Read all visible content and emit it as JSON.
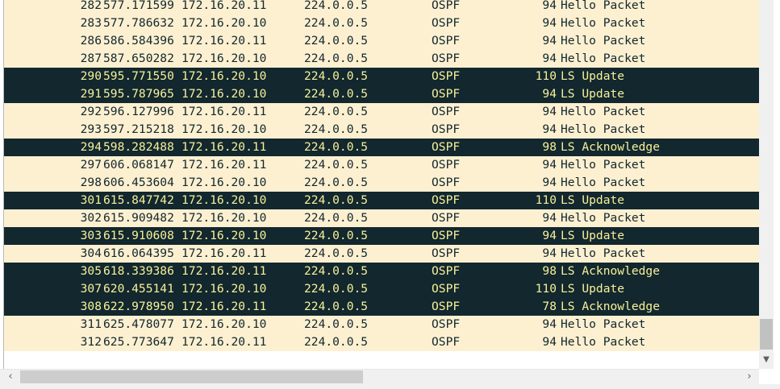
{
  "packets": [
    {
      "no": "282",
      "time": "577.171599",
      "src": "172.16.20.11",
      "dst": "224.0.0.5",
      "proto": "OSPF",
      "len": "94",
      "info": "Hello Packet",
      "highlight": false
    },
    {
      "no": "283",
      "time": "577.786632",
      "src": "172.16.20.10",
      "dst": "224.0.0.5",
      "proto": "OSPF",
      "len": "94",
      "info": "Hello Packet",
      "highlight": false
    },
    {
      "no": "286",
      "time": "586.584396",
      "src": "172.16.20.11",
      "dst": "224.0.0.5",
      "proto": "OSPF",
      "len": "94",
      "info": "Hello Packet",
      "highlight": false
    },
    {
      "no": "287",
      "time": "587.650282",
      "src": "172.16.20.10",
      "dst": "224.0.0.5",
      "proto": "OSPF",
      "len": "94",
      "info": "Hello Packet",
      "highlight": false
    },
    {
      "no": "290",
      "time": "595.771550",
      "src": "172.16.20.10",
      "dst": "224.0.0.5",
      "proto": "OSPF",
      "len": "110",
      "info": "LS Update",
      "highlight": true
    },
    {
      "no": "291",
      "time": "595.787965",
      "src": "172.16.20.10",
      "dst": "224.0.0.5",
      "proto": "OSPF",
      "len": "94",
      "info": "LS Update",
      "highlight": true
    },
    {
      "no": "292",
      "time": "596.127996",
      "src": "172.16.20.11",
      "dst": "224.0.0.5",
      "proto": "OSPF",
      "len": "94",
      "info": "Hello Packet",
      "highlight": false
    },
    {
      "no": "293",
      "time": "597.215218",
      "src": "172.16.20.10",
      "dst": "224.0.0.5",
      "proto": "OSPF",
      "len": "94",
      "info": "Hello Packet",
      "highlight": false
    },
    {
      "no": "294",
      "time": "598.282488",
      "src": "172.16.20.11",
      "dst": "224.0.0.5",
      "proto": "OSPF",
      "len": "98",
      "info": "LS Acknowledge",
      "highlight": true
    },
    {
      "no": "297",
      "time": "606.068147",
      "src": "172.16.20.11",
      "dst": "224.0.0.5",
      "proto": "OSPF",
      "len": "94",
      "info": "Hello Packet",
      "highlight": false
    },
    {
      "no": "298",
      "time": "606.453604",
      "src": "172.16.20.10",
      "dst": "224.0.0.5",
      "proto": "OSPF",
      "len": "94",
      "info": "Hello Packet",
      "highlight": false
    },
    {
      "no": "301",
      "time": "615.847742",
      "src": "172.16.20.10",
      "dst": "224.0.0.5",
      "proto": "OSPF",
      "len": "110",
      "info": "LS Update",
      "highlight": true
    },
    {
      "no": "302",
      "time": "615.909482",
      "src": "172.16.20.10",
      "dst": "224.0.0.5",
      "proto": "OSPF",
      "len": "94",
      "info": "Hello Packet",
      "highlight": false
    },
    {
      "no": "303",
      "time": "615.910608",
      "src": "172.16.20.10",
      "dst": "224.0.0.5",
      "proto": "OSPF",
      "len": "94",
      "info": "LS Update",
      "highlight": true
    },
    {
      "no": "304",
      "time": "616.064395",
      "src": "172.16.20.11",
      "dst": "224.0.0.5",
      "proto": "OSPF",
      "len": "94",
      "info": "Hello Packet",
      "highlight": false
    },
    {
      "no": "305",
      "time": "618.339386",
      "src": "172.16.20.11",
      "dst": "224.0.0.5",
      "proto": "OSPF",
      "len": "98",
      "info": "LS Acknowledge",
      "highlight": true
    },
    {
      "no": "307",
      "time": "620.455141",
      "src": "172.16.20.10",
      "dst": "224.0.0.5",
      "proto": "OSPF",
      "len": "110",
      "info": "LS Update",
      "highlight": true
    },
    {
      "no": "308",
      "time": "622.978950",
      "src": "172.16.20.11",
      "dst": "224.0.0.5",
      "proto": "OSPF",
      "len": "78",
      "info": "LS Acknowledge",
      "highlight": true
    },
    {
      "no": "311",
      "time": "625.478077",
      "src": "172.16.20.10",
      "dst": "224.0.0.5",
      "proto": "OSPF",
      "len": "94",
      "info": "Hello Packet",
      "highlight": false
    },
    {
      "no": "312",
      "time": "625.773647",
      "src": "172.16.20.11",
      "dst": "224.0.0.5",
      "proto": "OSPF",
      "len": "94",
      "info": "Hello Packet",
      "highlight": false
    }
  ],
  "scrollbars": {
    "vertical_down_icon": "chevron-down-icon",
    "horizontal_left_icon": "chevron-left-icon",
    "horizontal_right_icon": "chevron-right-icon"
  },
  "colors": {
    "row_background": "#fdf0d1",
    "row_text": "#12272e",
    "highlight_background": "#12272e",
    "highlight_text": "#f7f19a"
  }
}
